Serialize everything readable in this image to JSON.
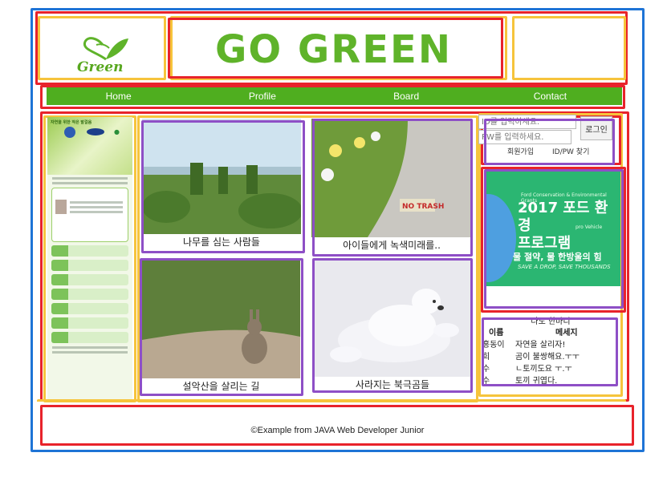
{
  "header": {
    "logo_text": "Green",
    "title": "GO GREEN"
  },
  "nav": {
    "items": [
      {
        "label": "Home"
      },
      {
        "label": "Profile"
      },
      {
        "label": "Board"
      },
      {
        "label": "Contact"
      }
    ]
  },
  "poster": {
    "title": "자연을 위한 작은 발걸음"
  },
  "tiles": [
    {
      "caption": "나무를 심는 사람들"
    },
    {
      "caption": "아이들에게 녹색미래를.."
    },
    {
      "caption": "설악산을 살리는 길"
    },
    {
      "caption": "사라지는 북극곰들"
    }
  ],
  "sign_text": "NO TRASH",
  "login": {
    "id_placeholder": "ID를 입력하세요.",
    "pw_placeholder": "PW를 입력하세요.",
    "button_label": "로그인",
    "signup_label": "회원가입",
    "find_label": "ID/PW 찾기"
  },
  "ad": {
    "grants_text": "Ford Conservation & Environmental Grants",
    "title_line1": "2017 포드 환경",
    "title_line2": "프로그램",
    "car_text": "pro Vehicle",
    "subtitle": "물 절약, 물 한방울의 힘",
    "subtitle_en": "SAVE A DROP, SAVE THOUSANDS"
  },
  "guestbook": {
    "title": "나도 한마디",
    "col_name": "이름",
    "col_message": "메세지",
    "rows": [
      {
        "name": "홍동이",
        "message": "자연을 살리자!"
      },
      {
        "name": "희",
        "message": "곰이 불쌍해요.ㅜㅜ"
      },
      {
        "name": "수",
        "message": "ㄴ토끼도요 ㅜ.ㅜ"
      },
      {
        "name": "수",
        "message": "토끼 귀엽다."
      }
    ]
  },
  "footer": {
    "text": "©Example from JAVA Web Developer Junior"
  },
  "colors": {
    "brand_green": "#4fae1f",
    "sketch_blue": "#1e74d6",
    "sketch_red": "#e8232b",
    "sketch_yellow": "#f6c43c",
    "sketch_purple": "#8e4fc6"
  }
}
